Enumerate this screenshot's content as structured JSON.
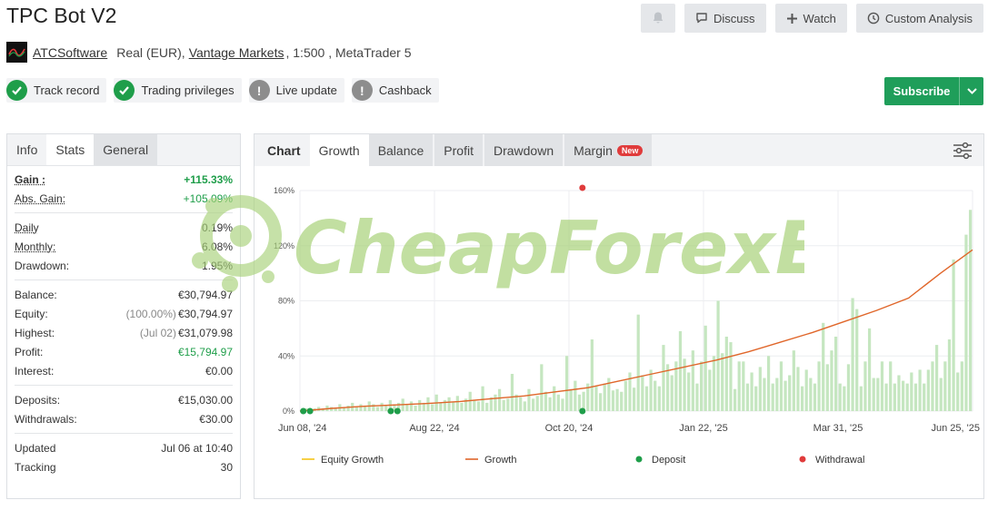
{
  "header": {
    "title": "TPC Bot V2",
    "discuss_label": "Discuss",
    "watch_label": "Watch",
    "custom_analysis_label": "Custom Analysis"
  },
  "account": {
    "developer": "ATCSoftware",
    "type": "Real (EUR),",
    "broker": "Vantage Markets",
    "details": ", 1:500 , MetaTrader 5"
  },
  "badges": [
    {
      "label": "Track record",
      "status": "ok"
    },
    {
      "label": "Trading privileges",
      "status": "ok"
    },
    {
      "label": "Live update",
      "status": "warn"
    },
    {
      "label": "Cashback",
      "status": "warn"
    }
  ],
  "subscribe": {
    "label": "Subscribe"
  },
  "left_tabs": [
    "Info",
    "Stats",
    "General"
  ],
  "stats": {
    "gain": {
      "label": "Gain :",
      "value": "+115.33%"
    },
    "abs_gain": {
      "label": "Abs. Gain:",
      "value": "+105.09%"
    },
    "daily": {
      "label": "Daily",
      "value": "0.19%"
    },
    "monthly": {
      "label": "Monthly:",
      "value": "6.08%"
    },
    "drawdown": {
      "label": "Drawdown:",
      "value": "1.95%"
    },
    "balance": {
      "label": "Balance:",
      "value": "€30,794.97"
    },
    "equity": {
      "label": "Equity:",
      "note": "(100.00%)",
      "value": "€30,794.97"
    },
    "highest": {
      "label": "Highest:",
      "note": "(Jul 02)",
      "value": "€31,079.98"
    },
    "profit": {
      "label": "Profit:",
      "value": "€15,794.97"
    },
    "interest": {
      "label": "Interest:",
      "value": "€0.00"
    },
    "deposits": {
      "label": "Deposits:",
      "value": "€15,030.00"
    },
    "withdrawals": {
      "label": "Withdrawals:",
      "value": "€30.00"
    },
    "updated": {
      "label": "Updated",
      "value": "Jul 06 at 10:40"
    },
    "tracking": {
      "label": "Tracking",
      "value": "30"
    }
  },
  "chart_tabs": {
    "label": "Chart",
    "tabs": [
      "Growth",
      "Balance",
      "Profit",
      "Drawdown",
      "Margin"
    ],
    "new_badge": "New"
  },
  "watermark": "CheapForexEa",
  "colors": {
    "accent_green": "#1f9e5a",
    "growth_line": "#e0662a",
    "equity_line": "#f5c518",
    "bar": "#c5e6c0",
    "deposit": "#1f9e4a",
    "withdrawal": "#e03b3b"
  },
  "chart_data": {
    "type": "line",
    "x_ticks": [
      "Jun 08, '24",
      "Aug 22, '24",
      "Oct 20, '24",
      "Jan 22, '25",
      "Mar 31, '25",
      "Jun 25, '25"
    ],
    "y_ticks": [
      "0%",
      "40%",
      "80%",
      "120%",
      "160%"
    ],
    "ylim": [
      0,
      160
    ],
    "legend": [
      "Equity Growth",
      "Growth",
      "Deposit",
      "Withdrawal"
    ],
    "legend_position": "bottom",
    "growth_points": [
      [
        0,
        0
      ],
      [
        0.06,
        2
      ],
      [
        0.12,
        3.5
      ],
      [
        0.18,
        4.5
      ],
      [
        0.24,
        5.5
      ],
      [
        0.3,
        7
      ],
      [
        0.36,
        9
      ],
      [
        0.42,
        11
      ],
      [
        0.48,
        14
      ],
      [
        0.52,
        17
      ],
      [
        0.56,
        22
      ],
      [
        0.6,
        27
      ],
      [
        0.64,
        32
      ],
      [
        0.68,
        37
      ],
      [
        0.72,
        43
      ],
      [
        0.76,
        50
      ],
      [
        0.8,
        57
      ],
      [
        0.84,
        65
      ],
      [
        0.88,
        73
      ],
      [
        0.92,
        82
      ],
      [
        0.96,
        100
      ],
      [
        1,
        100
      ]
    ],
    "growth_values": [
      0,
      2,
      3.5,
      4.5,
      5.5,
      7,
      9,
      11,
      14,
      17,
      22,
      27,
      32,
      37,
      43,
      50,
      57,
      65,
      73,
      82,
      100,
      117
    ],
    "bar_values": [
      1,
      2,
      1,
      2,
      3,
      2,
      4,
      3,
      2,
      5,
      3,
      4,
      6,
      3,
      5,
      4,
      7,
      5,
      3,
      6,
      4,
      8,
      5,
      6,
      9,
      5,
      7,
      4,
      8,
      6,
      10,
      5,
      12,
      6,
      8,
      10,
      7,
      11,
      6,
      9,
      14,
      8,
      7,
      18,
      6,
      10,
      12,
      16,
      8,
      9,
      27,
      12,
      10,
      7,
      16,
      9,
      11,
      34,
      14,
      10,
      18,
      12,
      9,
      40,
      16,
      22,
      12,
      14,
      20,
      52,
      18,
      13,
      20,
      24,
      15,
      16,
      14,
      22,
      28,
      17,
      70,
      26,
      18,
      30,
      22,
      18,
      48,
      34,
      26,
      36,
      58,
      38,
      28,
      44,
      20,
      36,
      62,
      30,
      40,
      80,
      42,
      54,
      50,
      16,
      36,
      36,
      20,
      28,
      18,
      32,
      24,
      40,
      20,
      24,
      36,
      22,
      26,
      44,
      32,
      18,
      30,
      24,
      20,
      36,
      64,
      34,
      44,
      54,
      20,
      18,
      34,
      82,
      74,
      18,
      36,
      60,
      24,
      24,
      36,
      20,
      36,
      20,
      26,
      22,
      20,
      28,
      20,
      30,
      20,
      30,
      36,
      48,
      24,
      36,
      52,
      110,
      28,
      36,
      128,
      146
    ],
    "deposits_x": [
      0.005,
      0.015,
      0.135,
      0.145,
      0.42
    ],
    "withdrawal": {
      "x": 0.42,
      "y": 162
    }
  }
}
